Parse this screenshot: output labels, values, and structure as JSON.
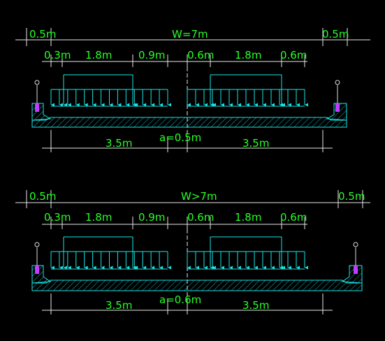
{
  "colors": {
    "background": "#000000",
    "text": "#27ff27",
    "load": "#19e6e6",
    "dimension": "#e8e8e8",
    "post": "#c03cff"
  },
  "sections": [
    {
      "id": "section-w7",
      "width_label": "W=7m",
      "side_left": "0.5m",
      "side_right": "0.5m",
      "left_lane": {
        "offset": "0.3m",
        "axle": "1.8m",
        "gap": "0.9m"
      },
      "right_lane": {
        "offset": "0.6m",
        "axle": "1.8m",
        "gap": "0.6m"
      },
      "lane_left": "3.5m",
      "lane_right": "3.5m",
      "center": "a=0.5m"
    },
    {
      "id": "section-wgt7",
      "width_label": "W>7m",
      "side_left": "0.5m",
      "side_right": "0.5m",
      "left_lane": {
        "offset": "0.3m",
        "axle": "1.8m",
        "gap": "0.9m"
      },
      "right_lane": {
        "offset": "0.6m",
        "axle": "1.8m",
        "gap": "0.6m"
      },
      "lane_left": "3.5m",
      "lane_right": "3.5m",
      "center": "a=0.6m"
    }
  ]
}
